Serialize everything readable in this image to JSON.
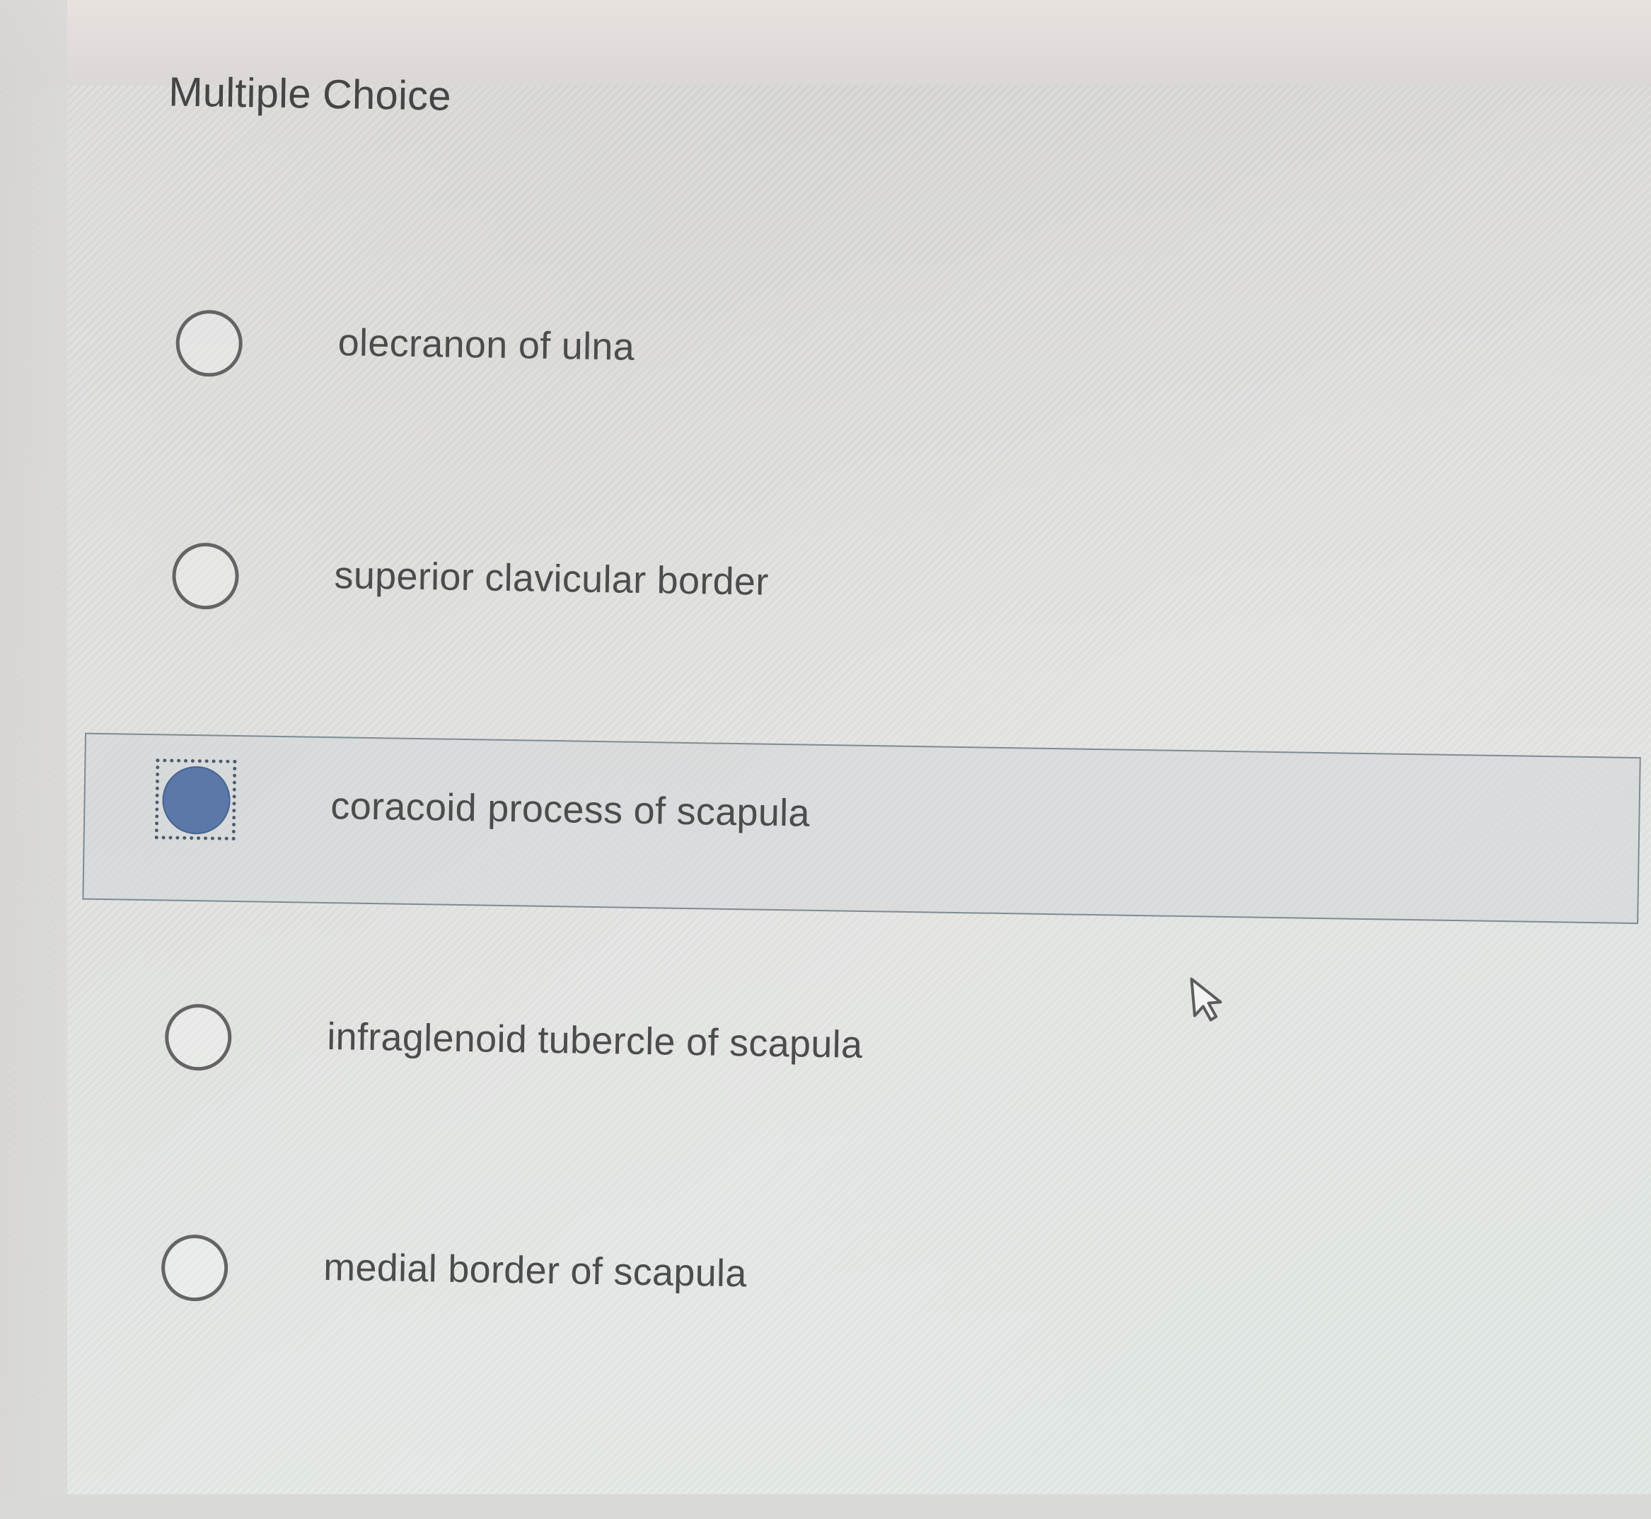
{
  "question": {
    "type_label": "Multiple Choice"
  },
  "options": [
    {
      "label": "olecranon of ulna",
      "selected": false
    },
    {
      "label": "superior clavicular border",
      "selected": false
    },
    {
      "label": "coracoid process of scapula",
      "selected": true
    },
    {
      "label": "infraglenoid tubercle of scapula",
      "selected": false
    },
    {
      "label": "medial border of scapula",
      "selected": false
    }
  ],
  "colors": {
    "selected_radio": "#5b78a8",
    "text": "#4c4c4c",
    "border": "#7f8b92"
  },
  "icons": {
    "pointer": "mouse-pointer-icon"
  }
}
